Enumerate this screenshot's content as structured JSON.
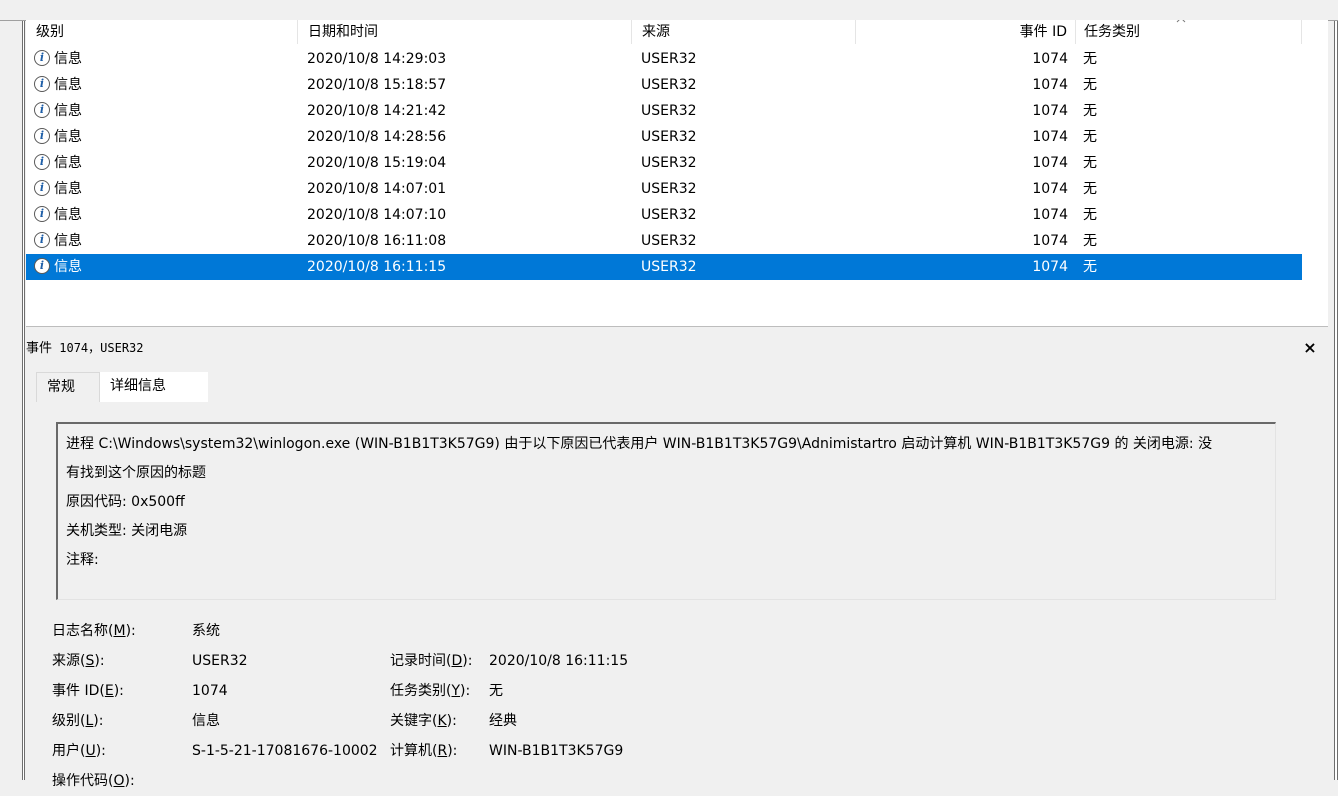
{
  "table": {
    "columns": {
      "level": "级别",
      "date": "日期和时间",
      "source": "来源",
      "event_id": "事件 ID",
      "task": "任务类别"
    },
    "rows": [
      {
        "level": "信息",
        "date": "2020/10/8 14:29:03",
        "source": "USER32",
        "event_id": "1074",
        "task": "无"
      },
      {
        "level": "信息",
        "date": "2020/10/8 15:18:57",
        "source": "USER32",
        "event_id": "1074",
        "task": "无"
      },
      {
        "level": "信息",
        "date": "2020/10/8 14:21:42",
        "source": "USER32",
        "event_id": "1074",
        "task": "无"
      },
      {
        "level": "信息",
        "date": "2020/10/8 14:28:56",
        "source": "USER32",
        "event_id": "1074",
        "task": "无"
      },
      {
        "level": "信息",
        "date": "2020/10/8 15:19:04",
        "source": "USER32",
        "event_id": "1074",
        "task": "无"
      },
      {
        "level": "信息",
        "date": "2020/10/8 14:07:01",
        "source": "USER32",
        "event_id": "1074",
        "task": "无"
      },
      {
        "level": "信息",
        "date": "2020/10/8 14:07:10",
        "source": "USER32",
        "event_id": "1074",
        "task": "无"
      },
      {
        "level": "信息",
        "date": "2020/10/8 16:11:08",
        "source": "USER32",
        "event_id": "1074",
        "task": "无"
      },
      {
        "level": "信息",
        "date": "2020/10/8 16:11:15",
        "source": "USER32",
        "event_id": "1074",
        "task": "无"
      }
    ]
  },
  "detail": {
    "title_prefix": "事件",
    "title_mono": " 1074，USER32",
    "close_glyph": "×",
    "tabs": [
      "常规",
      "详细信息"
    ],
    "description": [
      "进程 C:\\Windows\\system32\\winlogon.exe (WIN-B1B1T3K57G9) 由于以下原因已代表用户 WIN-B1B1T3K57G9\\Adnimistartro 启动计算机 WIN-B1B1T3K57G9 的 关闭电源: 没",
      "有找到这个原因的标题",
      "原因代码: 0x500ff",
      "关机类型: 关闭电源",
      "注释:"
    ],
    "props": {
      "log_name": {
        "label": "日志名称(",
        "key": "M",
        "value": "系统"
      },
      "source": {
        "label": "来源(",
        "key": "S",
        "value": "USER32"
      },
      "logged": {
        "label": "记录时间(",
        "key": "D",
        "value": "2020/10/8 16:11:15"
      },
      "event_id": {
        "label": "事件 ID(",
        "key": "E",
        "value": "1074"
      },
      "task": {
        "label": "任务类别(",
        "key": "Y",
        "value": "无"
      },
      "level": {
        "label": "级别(",
        "key": "L",
        "value": "信息"
      },
      "keywords": {
        "label": "关键字(",
        "key": "K",
        "value": "经典"
      },
      "user": {
        "label": "用户(",
        "key": "U",
        "value": "S-1-5-21-17081676-10002"
      },
      "computer": {
        "label": "计算机(",
        "key": "R",
        "value": "WIN-B1B1T3K57G9"
      },
      "opcode": {
        "label": "操作代码(",
        "key": "O",
        "value": ""
      }
    },
    "label_suffix": "):"
  },
  "colors": {
    "selection": "#0078d7",
    "info_icon": "#1f5fa8"
  }
}
